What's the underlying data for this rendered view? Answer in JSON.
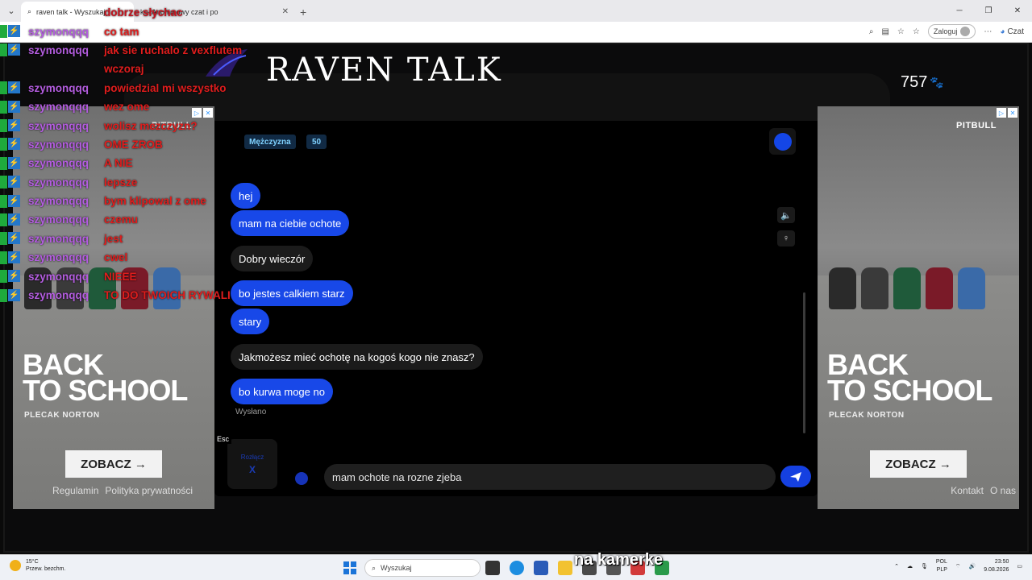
{
  "browser": {
    "tabs": [
      {
        "label": "raven talk - Wyszukaj"
      },
      {
        "label": "k – Anonimowy czat i po"
      }
    ],
    "login_label": "Zaloguj",
    "copilot_label": "Czat"
  },
  "site": {
    "brand": "RAVEN TALK",
    "online_count": "757",
    "footer_links_left": [
      "Regulamin",
      "Polityka prywatności"
    ],
    "footer_links_right": [
      "Kontakt",
      "O nas"
    ]
  },
  "ad": {
    "brand": "PITBULL",
    "headline_1": "BACK",
    "headline_2": "TO SCHOOL",
    "subline": "PLECAK NORTON",
    "cta": "ZOBACZ →"
  },
  "chat": {
    "partner_gender": "Mężczyzna",
    "partner_age": "50",
    "messages": [
      {
        "from": "me",
        "text": "hej"
      },
      {
        "from": "me",
        "text": "mam na ciebie ochote"
      },
      {
        "from": "them",
        "text": "Dobry wieczór"
      },
      {
        "from": "me",
        "text": "bo jestes calkiem starz"
      },
      {
        "from": "me",
        "text": "stary"
      },
      {
        "from": "them",
        "text": "Jakmożesz mieć ochotę na kogoś kogo nie znasz?"
      },
      {
        "from": "me",
        "text": "bo kurwa moge no"
      }
    ],
    "sent_status": "Wysłano",
    "esc_label": "Esc",
    "input_value": "mam ochote na rozne zjeba",
    "skip_label": "Rozłącz",
    "skip_key": "X"
  },
  "stream_overlay": {
    "lines": [
      {
        "user": "",
        "text": "dobrze słychac"
      },
      {
        "user": "szymonqqq",
        "text": "co tam"
      },
      {
        "user": "szymonqqq",
        "text": "jak sie ruchalo z vexflutem"
      },
      {
        "user": "",
        "text": "wczoraj"
      },
      {
        "user": "szymonqqq",
        "text": "powiedzial mi wszystko"
      },
      {
        "user": "szymonqqq",
        "text": "wez ome"
      },
      {
        "user": "szymonqqq",
        "text": "wolisz mezczyzn?"
      },
      {
        "user": "szymonqqq",
        "text": "OME ZROB"
      },
      {
        "user": "szymonqqq",
        "text": "A NIE"
      },
      {
        "user": "szymonqqq",
        "text": "lepsze"
      },
      {
        "user": "szymonqqq",
        "text": "bym klipowal z ome"
      },
      {
        "user": "szymonqqq",
        "text": "czemu"
      },
      {
        "user": "szymonqqq",
        "text": "jest"
      },
      {
        "user": "szymonqqq",
        "text": "cwel"
      },
      {
        "user": "szymonqqq",
        "text": "NIEEE"
      },
      {
        "user": "szymonqqq",
        "text": "TO DO TWOICH RYWALI"
      }
    ],
    "caption": "na kamerke"
  },
  "taskbar": {
    "weather_temp": "15°C",
    "weather_desc": "Przew. bezchm.",
    "search_placeholder": "Wyszukaj",
    "lang_1": "POL",
    "lang_2": "PLP",
    "time": "23:50",
    "date": "9.08.2026"
  },
  "colors": {
    "accent_blue": "#1848e8",
    "overlay_user": "#b45de0",
    "overlay_text": "#e01d1d"
  }
}
